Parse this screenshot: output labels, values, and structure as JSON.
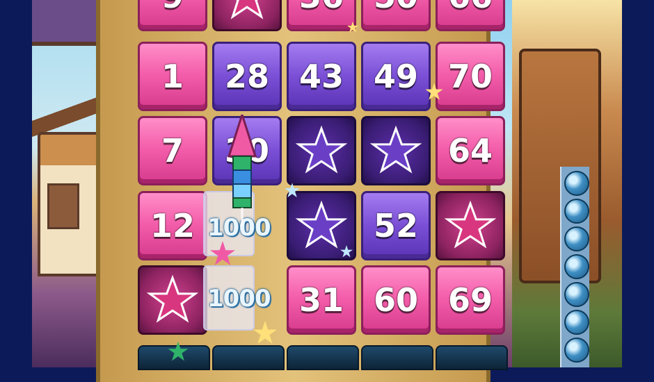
{
  "colors": {
    "pink_tile": "#f45fab",
    "purple_tile": "#7a4fd6",
    "daubed_purple": "#3a1d74",
    "daubed_pink": "#8d2360",
    "frame": "#0c1a5a",
    "board_gold": "#e3c27b"
  },
  "board": {
    "rows": [
      [
        {
          "type": "pink",
          "label": "9"
        },
        {
          "type": "daubed-pink",
          "icon": "star-icon"
        },
        {
          "type": "pink",
          "label": "36"
        },
        {
          "type": "pink",
          "label": "50"
        },
        {
          "type": "pink",
          "label": "66"
        }
      ],
      [
        {
          "type": "pink",
          "label": "1"
        },
        {
          "type": "purple",
          "label": "28"
        },
        {
          "type": "purple",
          "label": "43"
        },
        {
          "type": "purple",
          "label": "49"
        },
        {
          "type": "pink",
          "label": "70"
        }
      ],
      [
        {
          "type": "pink",
          "label": "7"
        },
        {
          "type": "purple",
          "label": "30"
        },
        {
          "type": "daubed-purple",
          "icon": "star-icon"
        },
        {
          "type": "daubed-purple",
          "icon": "star-icon"
        },
        {
          "type": "pink",
          "label": "64"
        }
      ],
      [
        {
          "type": "pink",
          "label": "12"
        },
        {
          "type": "bonus",
          "label": ""
        },
        {
          "type": "daubed-purple",
          "icon": "star-icon"
        },
        {
          "type": "purple",
          "label": "52"
        },
        {
          "type": "daubed-pink",
          "icon": "star-icon"
        }
      ],
      [
        {
          "type": "daubed-pink",
          "icon": "star-icon"
        },
        {
          "type": "bonus",
          "label": ""
        },
        {
          "type": "pink",
          "label": "31"
        },
        {
          "type": "pink",
          "label": "60"
        },
        {
          "type": "pink",
          "label": "69"
        }
      ]
    ]
  },
  "bonuses": {
    "upper": "1000",
    "lower": "1000"
  },
  "powerup": {
    "icon": "firework-rocket-icon"
  },
  "called_balls": {
    "icon": "bingo-ball-icon",
    "count_visible": 7
  }
}
